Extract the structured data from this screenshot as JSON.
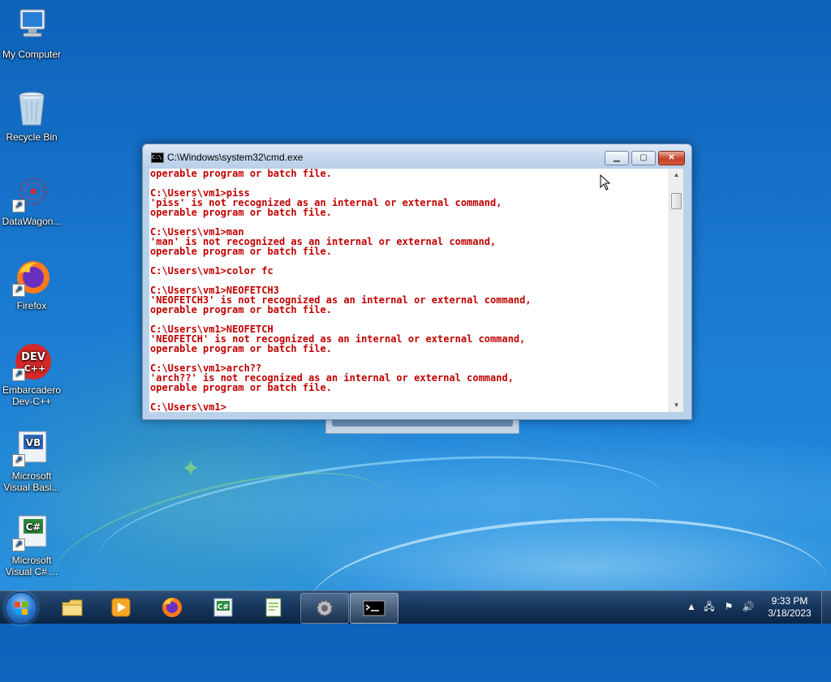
{
  "desktop": {
    "icons": [
      {
        "label": "My Computer"
      },
      {
        "label": "Recycle Bin"
      },
      {
        "label": "DataWagon..."
      },
      {
        "label": "Firefox"
      },
      {
        "label": "Embarcadero Dev-C++"
      },
      {
        "label": "Microsoft Visual Basi..."
      },
      {
        "label": "Microsoft Visual C# ..."
      }
    ]
  },
  "cmd_window": {
    "title": "C:\\Windows\\system32\\cmd.exe",
    "icon_text": "C:\\",
    "text_color": "#c00000",
    "lines": [
      "operable program or batch file.",
      "",
      "C:\\Users\\vm1>piss",
      "'piss' is not recognized as an internal or external command,",
      "operable program or batch file.",
      "",
      "C:\\Users\\vm1>man",
      "'man' is not recognized as an internal or external command,",
      "operable program or batch file.",
      "",
      "C:\\Users\\vm1>color fc",
      "",
      "C:\\Users\\vm1>NEOFETCH3",
      "'NEOFETCH3' is not recognized as an internal or external command,",
      "operable program or batch file.",
      "",
      "C:\\Users\\vm1>NEOFETCH",
      "'NEOFETCH' is not recognized as an internal or external command,",
      "operable program or batch file.",
      "",
      "C:\\Users\\vm1>arch??",
      "'arch??' is not recognized as an internal or external command,",
      "operable program or batch file.",
      "",
      "C:\\Users\\vm1>"
    ]
  },
  "taskbar": {
    "icons": [
      "windows-explorer-icon",
      "media-player-icon",
      "firefox-icon",
      "visual-csharp-icon",
      "notepad-plus-icon",
      "gear-icon",
      "cmd-icon"
    ],
    "clock": {
      "time": "9:33 PM",
      "date": "3/18/2023"
    }
  }
}
